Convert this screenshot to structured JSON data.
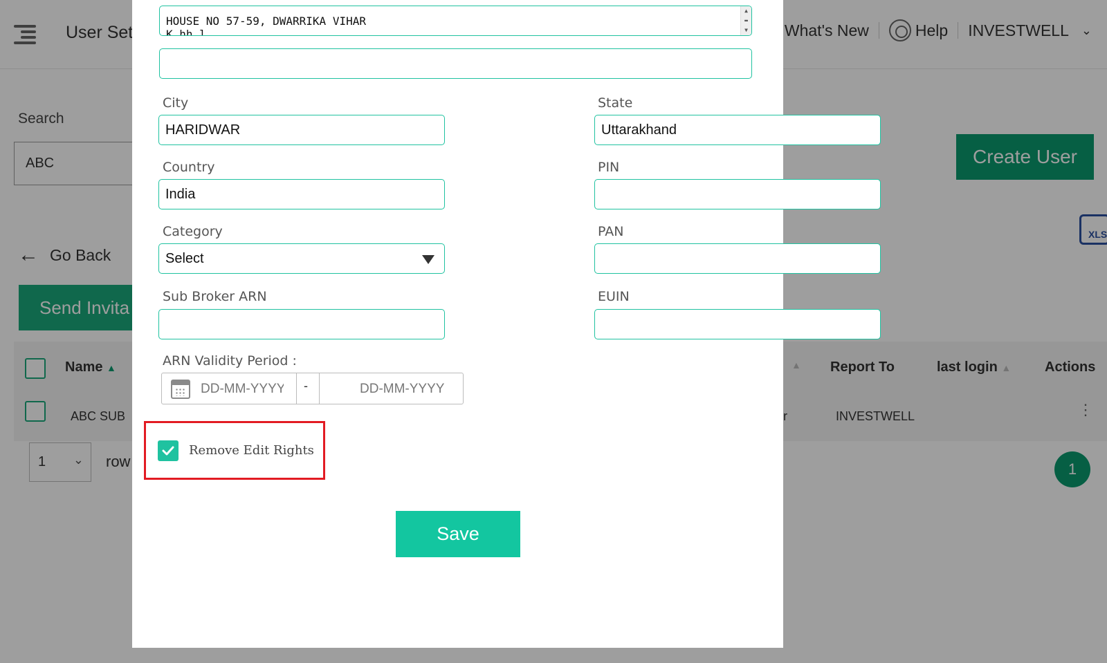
{
  "background": {
    "page_title": "User Set",
    "top_links": [
      "What's New",
      "Help",
      "INVESTWELL"
    ],
    "search_label": "Search",
    "search_value": "ABC",
    "create_user": "Create User",
    "xls": "XLS",
    "go_back": "Go Back",
    "send_invite": "Send Invita",
    "columns": [
      "Name",
      "Report To",
      "last login",
      "Actions"
    ],
    "row": {
      "name": "ABC SUB",
      "report_to": "INVESTWELL",
      "partial": "r"
    },
    "rows_per_page": "1",
    "rows_text": "row",
    "page_number": "1"
  },
  "modal": {
    "address_line1": "HOUSE NO 57-59, DWARRIKA VIHAR",
    "address_line1_overflow": "K    hh l",
    "address_line2": "",
    "fields": {
      "city": {
        "label": "City",
        "value": "HARIDWAR"
      },
      "state": {
        "label": "State",
        "value": "Uttarakhand"
      },
      "country": {
        "label": "Country",
        "value": "India"
      },
      "pin": {
        "label": "PIN",
        "value": ""
      },
      "category": {
        "label": "Category",
        "value": "Select"
      },
      "pan": {
        "label": "PAN",
        "value": ""
      },
      "sub_broker_arn": {
        "label": "Sub Broker ARN",
        "value": ""
      },
      "euin": {
        "label": "EUIN",
        "value": ""
      }
    },
    "arn_validity": {
      "label": "ARN Validity Period :",
      "from_placeholder": "DD-MM-YYYY",
      "separator": "-",
      "to_placeholder": "DD-MM-YYYY"
    },
    "remove_edit_rights": {
      "label": "Remove Edit Rights",
      "checked": true
    },
    "save": "Save"
  },
  "colors": {
    "accent": "#13c6a0",
    "field_border": "#1fc2a0",
    "highlight": "#e21b23",
    "dark_green": "#0a9a6e"
  }
}
